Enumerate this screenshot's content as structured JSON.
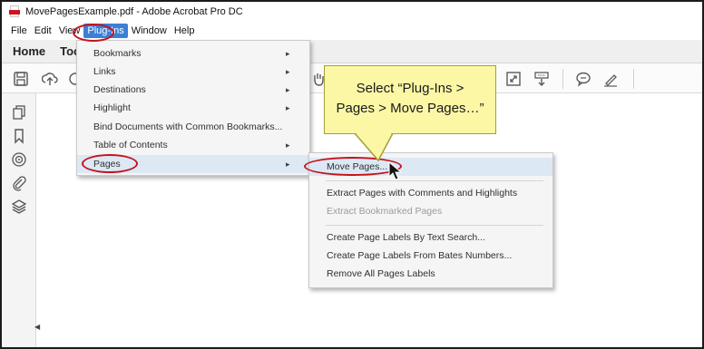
{
  "window": {
    "title": "MovePagesExample.pdf - Adobe Acrobat Pro DC",
    "app_icon": "pdf-file-icon"
  },
  "menubar": {
    "items": [
      "File",
      "Edit",
      "View",
      "Plug-Ins",
      "Window",
      "Help"
    ],
    "active": "Plug-Ins"
  },
  "homebar": {
    "tabs": [
      "Home",
      "Too"
    ]
  },
  "toolbar": {
    "icons": [
      "save-icon",
      "upload-icon",
      "share-icon",
      "hand-icon",
      "fit-page-icon",
      "scroll-mode-icon",
      "comment-icon",
      "pen-icon"
    ]
  },
  "left_rail": {
    "icons": [
      "pages-thumbnail-icon",
      "bookmark-icon",
      "destinations-icon",
      "attachment-icon",
      "layers-icon"
    ]
  },
  "plugins_menu": {
    "items": [
      {
        "label": "Bookmarks",
        "submenu": true
      },
      {
        "label": "Links",
        "submenu": true
      },
      {
        "label": "Destinations",
        "submenu": true
      },
      {
        "label": "Highlight",
        "submenu": true
      },
      {
        "label": "Bind Documents with Common Bookmarks...",
        "submenu": false
      },
      {
        "label": "Table of Contents",
        "submenu": true
      },
      {
        "label": "Pages",
        "submenu": true
      }
    ],
    "highlighted": "Pages"
  },
  "pages_submenu": {
    "groups": [
      [
        {
          "label": "Move Pages...",
          "enabled": true
        }
      ],
      [
        {
          "label": "Extract Pages with Comments and Highlights",
          "enabled": true
        },
        {
          "label": "Extract Bookmarked Pages",
          "enabled": false
        }
      ],
      [
        {
          "label": "Create Page Labels By Text Search...",
          "enabled": true
        },
        {
          "label": "Create Page Labels From Bates Numbers...",
          "enabled": true
        },
        {
          "label": "Remove All Pages Labels",
          "enabled": true
        }
      ]
    ],
    "highlighted": "Move Pages..."
  },
  "callout": {
    "line1": "Select “Plug-Ins >",
    "line2": "Pages > Move Pages…”"
  },
  "colors": {
    "menu_active": "#3b7fd6",
    "annotation_ring": "#c4141c",
    "callout_fill": "#fbf7a5",
    "menu_highlight": "#dde8f5"
  }
}
